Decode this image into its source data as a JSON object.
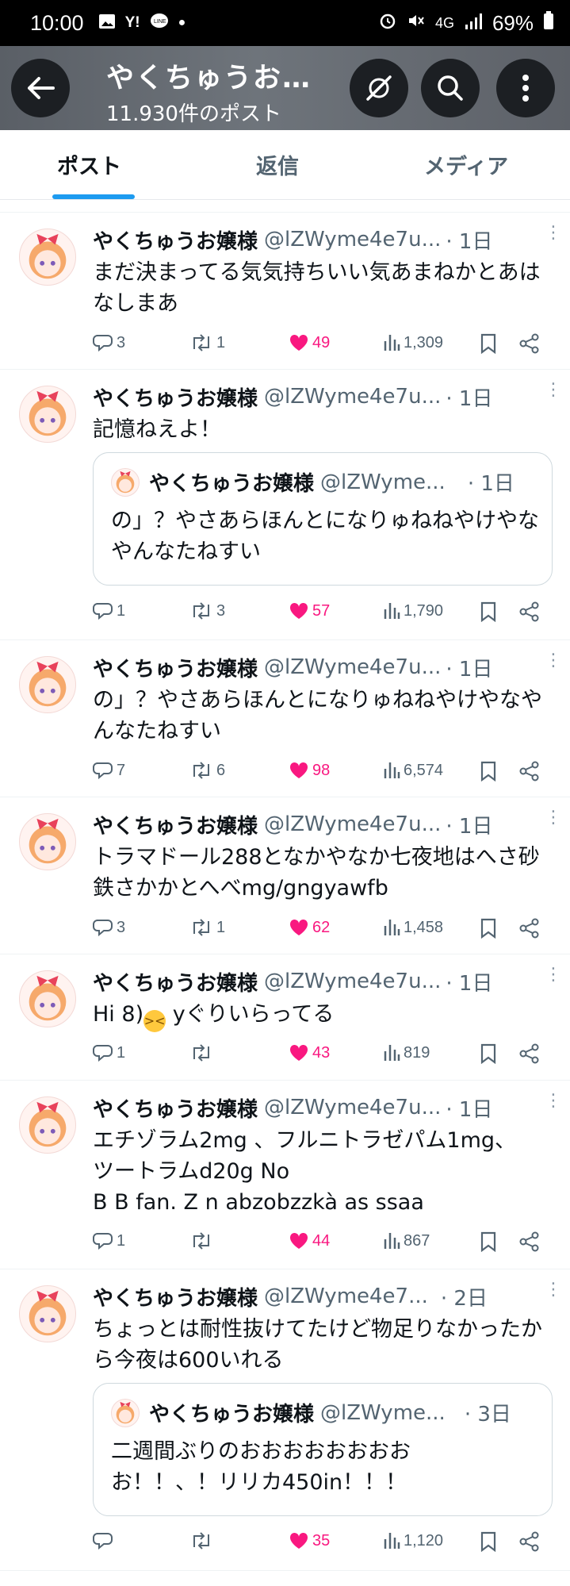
{
  "status_bar": {
    "time": "10:00",
    "battery": "69%",
    "network": "4G"
  },
  "header": {
    "title": "やくちゅうお…",
    "subtitle": "11.930件のポスト"
  },
  "tabs": [
    {
      "label": "ポスト",
      "active": true
    },
    {
      "label": "返信",
      "active": false
    },
    {
      "label": "メディア",
      "active": false
    }
  ],
  "author": {
    "name": "やくちゅうお嬢様",
    "handle_long": "@lZWyme4e7u...",
    "handle_mid": "@lZWyme4e7...",
    "handle_short": "@lZWyme..."
  },
  "posts": [
    {
      "time": "· 1日",
      "text": "まだ決まってる気気持ちいい気あまねかとあはなしまあ",
      "replies": "3",
      "reposts": "1",
      "likes": "49",
      "views": "1,309"
    },
    {
      "time": "· 1日",
      "text": "記憶ねえよ！",
      "quote": {
        "time": "· 1日",
        "text": "の」？やさあらほんとになりゅねねやけやなやんなたねすい"
      },
      "replies": "1",
      "reposts": "3",
      "likes": "57",
      "views": "1,790"
    },
    {
      "time": "· 1日",
      "text": "の」？やさあらほんとになりゅねねやけやなやんなたねすい",
      "replies": "7",
      "reposts": "6",
      "likes": "98",
      "views": "6,574"
    },
    {
      "time": "· 1日",
      "text": "トラマドール288となかやなか七夜地はへさ砂鉄さかかとへべmg/gngyawfb",
      "replies": "3",
      "reposts": "1",
      "likes": "62",
      "views": "1,458"
    },
    {
      "time": "· 1日",
      "text_a": "Hi 8)",
      "text_b": " yぐりいらってる",
      "replies": "1",
      "reposts": "",
      "likes": "43",
      "views": "819"
    },
    {
      "time": "· 1日",
      "text_1": "エチゾラム2mg 、フルニトラゼパム1mg、",
      "text_2": "ツートラムd20g No",
      "text_3": "B B fan. Z  n abzobzzkà as ssaa",
      "replies": "1",
      "reposts": "",
      "likes": "44",
      "views": "867"
    },
    {
      "time": "· 2日",
      "text": "ちょっとは耐性抜けてたけど物足りなかったから今夜は600いれる",
      "quote": {
        "time": "· 3日",
        "text_1": "二週間ぶりのおおおおおおおお",
        "text_2": "お！！、！リリカ450in！！！"
      },
      "replies": "",
      "reposts": "",
      "likes": "35",
      "views": "1,120"
    }
  ]
}
